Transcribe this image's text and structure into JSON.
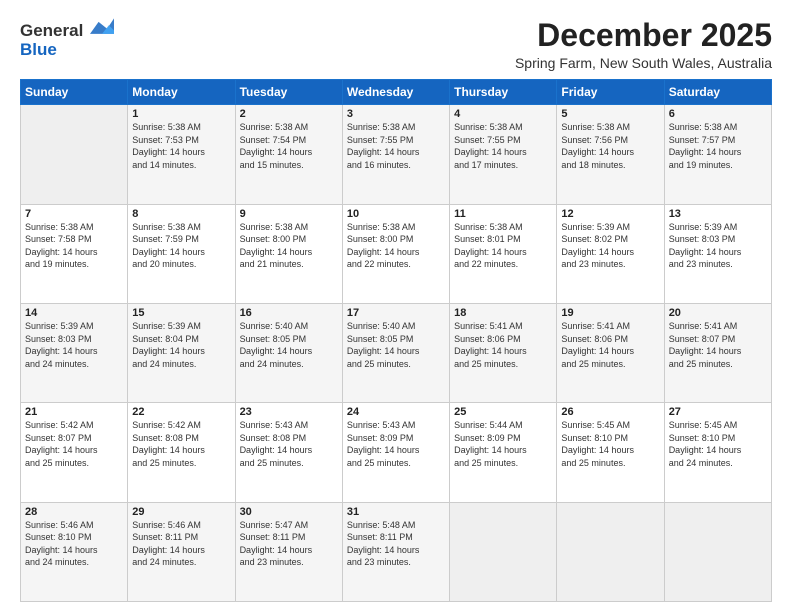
{
  "logo": {
    "general": "General",
    "blue": "Blue"
  },
  "header": {
    "month": "December 2025",
    "location": "Spring Farm, New South Wales, Australia"
  },
  "weekdays": [
    "Sunday",
    "Monday",
    "Tuesday",
    "Wednesday",
    "Thursday",
    "Friday",
    "Saturday"
  ],
  "weeks": [
    [
      {
        "day": "",
        "info": ""
      },
      {
        "day": "1",
        "info": "Sunrise: 5:38 AM\nSunset: 7:53 PM\nDaylight: 14 hours\nand 14 minutes."
      },
      {
        "day": "2",
        "info": "Sunrise: 5:38 AM\nSunset: 7:54 PM\nDaylight: 14 hours\nand 15 minutes."
      },
      {
        "day": "3",
        "info": "Sunrise: 5:38 AM\nSunset: 7:55 PM\nDaylight: 14 hours\nand 16 minutes."
      },
      {
        "day": "4",
        "info": "Sunrise: 5:38 AM\nSunset: 7:55 PM\nDaylight: 14 hours\nand 17 minutes."
      },
      {
        "day": "5",
        "info": "Sunrise: 5:38 AM\nSunset: 7:56 PM\nDaylight: 14 hours\nand 18 minutes."
      },
      {
        "day": "6",
        "info": "Sunrise: 5:38 AM\nSunset: 7:57 PM\nDaylight: 14 hours\nand 19 minutes."
      }
    ],
    [
      {
        "day": "7",
        "info": "Sunrise: 5:38 AM\nSunset: 7:58 PM\nDaylight: 14 hours\nand 19 minutes."
      },
      {
        "day": "8",
        "info": "Sunrise: 5:38 AM\nSunset: 7:59 PM\nDaylight: 14 hours\nand 20 minutes."
      },
      {
        "day": "9",
        "info": "Sunrise: 5:38 AM\nSunset: 8:00 PM\nDaylight: 14 hours\nand 21 minutes."
      },
      {
        "day": "10",
        "info": "Sunrise: 5:38 AM\nSunset: 8:00 PM\nDaylight: 14 hours\nand 22 minutes."
      },
      {
        "day": "11",
        "info": "Sunrise: 5:38 AM\nSunset: 8:01 PM\nDaylight: 14 hours\nand 22 minutes."
      },
      {
        "day": "12",
        "info": "Sunrise: 5:39 AM\nSunset: 8:02 PM\nDaylight: 14 hours\nand 23 minutes."
      },
      {
        "day": "13",
        "info": "Sunrise: 5:39 AM\nSunset: 8:03 PM\nDaylight: 14 hours\nand 23 minutes."
      }
    ],
    [
      {
        "day": "14",
        "info": "Sunrise: 5:39 AM\nSunset: 8:03 PM\nDaylight: 14 hours\nand 24 minutes."
      },
      {
        "day": "15",
        "info": "Sunrise: 5:39 AM\nSunset: 8:04 PM\nDaylight: 14 hours\nand 24 minutes."
      },
      {
        "day": "16",
        "info": "Sunrise: 5:40 AM\nSunset: 8:05 PM\nDaylight: 14 hours\nand 24 minutes."
      },
      {
        "day": "17",
        "info": "Sunrise: 5:40 AM\nSunset: 8:05 PM\nDaylight: 14 hours\nand 25 minutes."
      },
      {
        "day": "18",
        "info": "Sunrise: 5:41 AM\nSunset: 8:06 PM\nDaylight: 14 hours\nand 25 minutes."
      },
      {
        "day": "19",
        "info": "Sunrise: 5:41 AM\nSunset: 8:06 PM\nDaylight: 14 hours\nand 25 minutes."
      },
      {
        "day": "20",
        "info": "Sunrise: 5:41 AM\nSunset: 8:07 PM\nDaylight: 14 hours\nand 25 minutes."
      }
    ],
    [
      {
        "day": "21",
        "info": "Sunrise: 5:42 AM\nSunset: 8:07 PM\nDaylight: 14 hours\nand 25 minutes."
      },
      {
        "day": "22",
        "info": "Sunrise: 5:42 AM\nSunset: 8:08 PM\nDaylight: 14 hours\nand 25 minutes."
      },
      {
        "day": "23",
        "info": "Sunrise: 5:43 AM\nSunset: 8:08 PM\nDaylight: 14 hours\nand 25 minutes."
      },
      {
        "day": "24",
        "info": "Sunrise: 5:43 AM\nSunset: 8:09 PM\nDaylight: 14 hours\nand 25 minutes."
      },
      {
        "day": "25",
        "info": "Sunrise: 5:44 AM\nSunset: 8:09 PM\nDaylight: 14 hours\nand 25 minutes."
      },
      {
        "day": "26",
        "info": "Sunrise: 5:45 AM\nSunset: 8:10 PM\nDaylight: 14 hours\nand 25 minutes."
      },
      {
        "day": "27",
        "info": "Sunrise: 5:45 AM\nSunset: 8:10 PM\nDaylight: 14 hours\nand 24 minutes."
      }
    ],
    [
      {
        "day": "28",
        "info": "Sunrise: 5:46 AM\nSunset: 8:10 PM\nDaylight: 14 hours\nand 24 minutes."
      },
      {
        "day": "29",
        "info": "Sunrise: 5:46 AM\nSunset: 8:11 PM\nDaylight: 14 hours\nand 24 minutes."
      },
      {
        "day": "30",
        "info": "Sunrise: 5:47 AM\nSunset: 8:11 PM\nDaylight: 14 hours\nand 23 minutes."
      },
      {
        "day": "31",
        "info": "Sunrise: 5:48 AM\nSunset: 8:11 PM\nDaylight: 14 hours\nand 23 minutes."
      },
      {
        "day": "",
        "info": ""
      },
      {
        "day": "",
        "info": ""
      },
      {
        "day": "",
        "info": ""
      }
    ]
  ]
}
